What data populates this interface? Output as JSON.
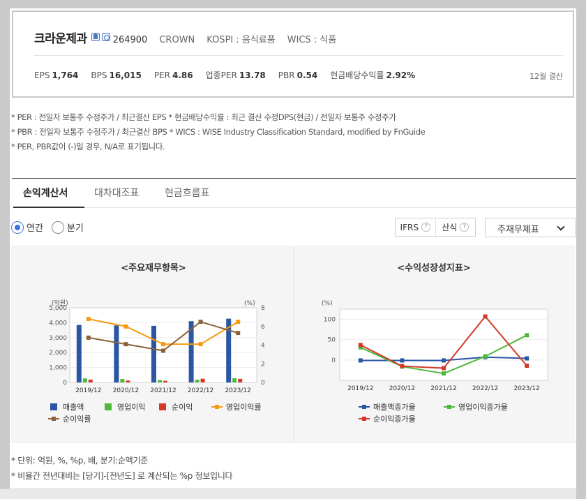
{
  "company": {
    "name": "크라운제과",
    "code": "264900",
    "english": "CROWN",
    "market": "KOSPI : 음식료품",
    "wics": "WICS : 식품",
    "icons": [
      "home-icon",
      "report-icon"
    ]
  },
  "stats": [
    {
      "label": "EPS",
      "value": "1,764"
    },
    {
      "label": "BPS",
      "value": "16,015"
    },
    {
      "label": "PER",
      "value": "4.86"
    },
    {
      "label": "업종PER",
      "value": "13.78"
    },
    {
      "label": "PBR",
      "value": "0.54"
    },
    {
      "label": "현금배당수익률",
      "value": "2.92%"
    }
  ],
  "settlement": "12월 결산",
  "notes": [
    "* PER : 전일자 보통주 수정주가 / 최근결산 EPS * 현금배당수익률 : 최근 결산 수정DPS(현금) / 전일자 보통주 수정주가",
    "* PBR : 전일자 보통주 수정주가 / 최근결산 BPS * WICS : WISE Industry Classification Standard, modified by FnGuide",
    "* PER, PBR값이 (-)일 경우, N/A로 표기됩니다."
  ],
  "tabs": [
    {
      "label": "손익계산서",
      "active": true
    },
    {
      "label": "대차대조표",
      "active": false
    },
    {
      "label": "현금흐름표",
      "active": false
    }
  ],
  "period": {
    "annual": "연간",
    "quarter": "분기",
    "selected": "annual"
  },
  "options": {
    "ifrs": "IFRS",
    "calc": "산식",
    "select_value": "주재무제표"
  },
  "chart_data": [
    {
      "type": "bar",
      "title": "<주요재무항목>",
      "ylabel_left": "(억원)",
      "ylabel_right": "(%)",
      "categories": [
        "2019/12",
        "2020/12",
        "2021/12",
        "2022/12",
        "2023/12"
      ],
      "ylim": [
        0,
        5000
      ],
      "ylim_right": [
        0,
        8
      ],
      "left_ticks": [
        "5,000",
        "4,000",
        "3,000",
        "2,000",
        "1,000",
        "0"
      ],
      "right_ticks": [
        "8",
        "6",
        "4",
        "2",
        "0"
      ],
      "series": [
        {
          "name": "매출액",
          "kind": "bar",
          "axis": "left",
          "color": "#2a56a3",
          "values": [
            3850,
            3820,
            3790,
            4100,
            4270
          ]
        },
        {
          "name": "영업이익",
          "kind": "bar",
          "axis": "left",
          "color": "#4fb83c",
          "values": [
            270,
            230,
            160,
            180,
            280
          ]
        },
        {
          "name": "순이익",
          "kind": "bar",
          "axis": "left",
          "color": "#d33a2a",
          "values": [
            190,
            130,
            110,
            250,
            240
          ]
        },
        {
          "name": "영업이익률",
          "kind": "line",
          "axis": "right",
          "color": "#f59a12",
          "values": [
            6.8,
            6.0,
            4.1,
            4.1,
            6.5
          ]
        },
        {
          "name": "순이익률",
          "kind": "line",
          "axis": "right",
          "color": "#8c6239",
          "values": [
            4.8,
            4.1,
            3.4,
            6.5,
            5.3
          ]
        }
      ]
    },
    {
      "type": "line",
      "title": "<수익성장성지표>",
      "ylabel": "(%)",
      "categories": [
        "2019/12",
        "2020/12",
        "2021/12",
        "2022/12",
        "2023/12"
      ],
      "ylim": [
        -50,
        125
      ],
      "ticks": [
        "100",
        "50",
        "0"
      ],
      "series": [
        {
          "name": "매출액증가율",
          "color": "#2a56a3",
          "values": [
            -1,
            -1,
            -1,
            7,
            4
          ]
        },
        {
          "name": "영업이익증가율",
          "color": "#4fb83c",
          "values": [
            31,
            -16,
            -33,
            9,
            61
          ]
        },
        {
          "name": "순이익증가율",
          "color": "#d33a2a",
          "values": [
            37,
            -15,
            -20,
            107,
            -14
          ]
        }
      ]
    }
  ],
  "footnotes": [
    "* 단위: 억원, %, %p, 배, 분기:순액기준",
    "* 비율간 전년대비는 [당기]-[전년도] 로 계산되는 %p 정보입니다"
  ]
}
